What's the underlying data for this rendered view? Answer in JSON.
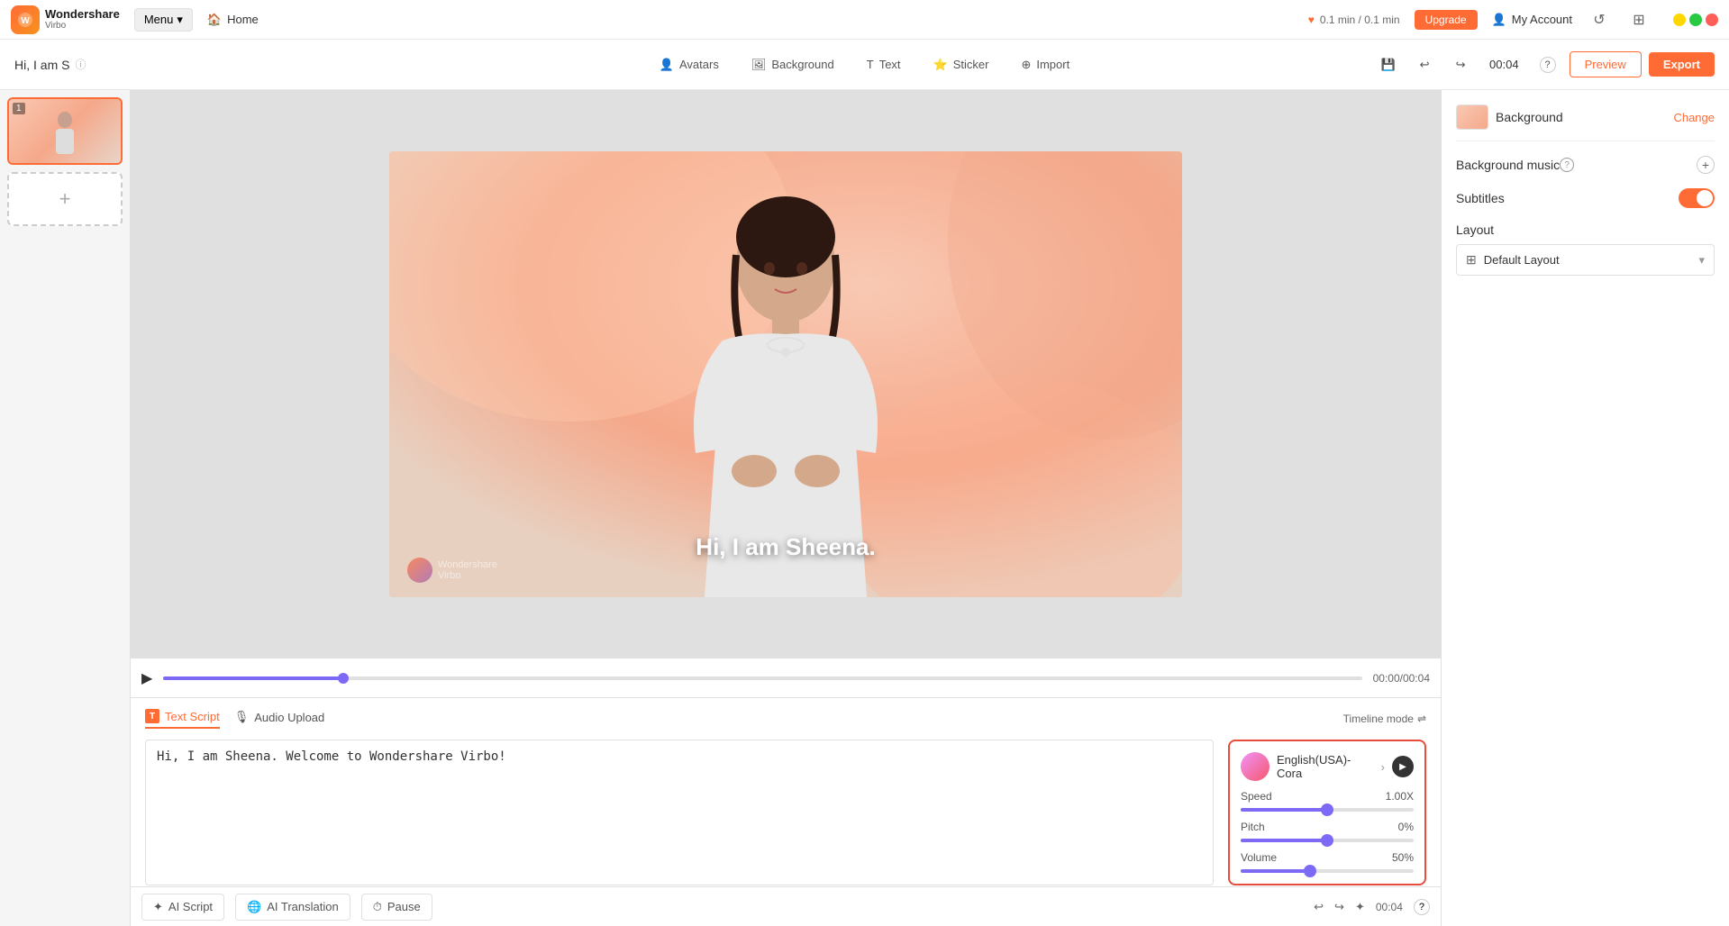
{
  "app": {
    "name": "Wondershare",
    "subname": "Virbo",
    "logo_text": "Wondershare\nVirbo"
  },
  "top_nav": {
    "menu_label": "Menu",
    "home_label": "Home",
    "credit_text": "0.1 min / 0.1 min",
    "upgrade_label": "Upgrade",
    "account_label": "My Account",
    "undo_icon": "↩",
    "redo_icon": "↪",
    "grid_icon": "⊞",
    "minimize_icon": "−",
    "maximize_icon": "□",
    "close_icon": "✕"
  },
  "toolbar": {
    "project_title": "Hi, I am S",
    "info_icon": "ⓘ",
    "avatars_label": "Avatars",
    "background_label": "Background",
    "text_label": "Text",
    "sticker_label": "Sticker",
    "import_label": "Import",
    "save_icon": "💾",
    "undo_icon": "↩",
    "redo_icon": "↪",
    "time_display": "00:04",
    "help_icon": "?",
    "preview_label": "Preview",
    "export_label": "Export"
  },
  "slides": {
    "items": [
      {
        "number": "1"
      }
    ],
    "add_label": "+"
  },
  "video": {
    "subtitle": "Hi, I am Sheena.",
    "watermark_text": "Wondershare\nVirbo"
  },
  "timeline": {
    "play_icon": "▶",
    "progress_percent": 15,
    "time_code": "00:00/00:04"
  },
  "script_panel": {
    "text_script_label": "Text Script",
    "audio_upload_label": "Audio Upload",
    "timeline_mode_label": "Timeline mode",
    "timeline_icon": "⇌",
    "script_text": "Hi, I am Sheena. Welcome to Wondershare Virbo!",
    "voice": {
      "name": "English(USA)-Cora",
      "speed_label": "Speed",
      "speed_value": "1.00X",
      "speed_percent": 50,
      "pitch_label": "Pitch",
      "pitch_value": "0%",
      "pitch_percent": 50,
      "volume_label": "Volume",
      "volume_value": "50%",
      "volume_percent": 40
    }
  },
  "bottom_toolbar": {
    "ai_script_label": "AI Script",
    "ai_translation_label": "AI Translation",
    "pause_label": "Pause",
    "time_code": "00:04",
    "help_icon": "?"
  },
  "right_panel": {
    "background_label": "Background",
    "change_label": "Change",
    "background_music_label": "Background music",
    "add_icon": "+",
    "subtitles_label": "Subtitles",
    "layout_label": "Layout",
    "layout_default": "Default Layout"
  },
  "ai_translation_bar": {
    "label": "AI Translation"
  }
}
